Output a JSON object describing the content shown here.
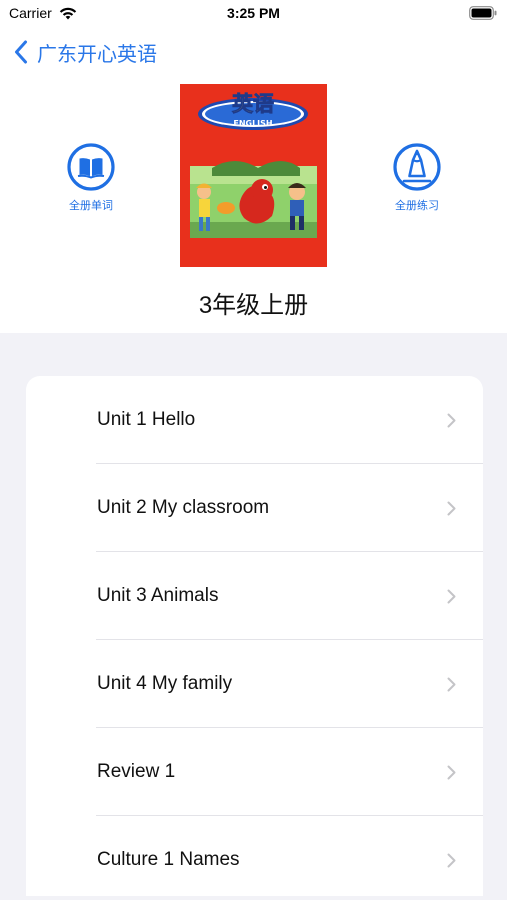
{
  "status_bar": {
    "carrier": "Carrier",
    "time": "3:25 PM"
  },
  "nav": {
    "back_label": "广东开心英语",
    "back_icon": "chevron-left-icon"
  },
  "actions": {
    "all_words": {
      "label": "全册单词",
      "icon": "book-open-icon"
    },
    "all_practice": {
      "label": "全册练习",
      "icon": "pencil-icon"
    }
  },
  "book": {
    "cover_title": "英语",
    "cover_subtitle": "ENGLISH",
    "title": "3年级上册"
  },
  "units": [
    {
      "label": "Unit 1 Hello"
    },
    {
      "label": "Unit 2 My classroom"
    },
    {
      "label": "Unit 3 Animals"
    },
    {
      "label": "Unit 4 My family"
    },
    {
      "label": "Review 1"
    },
    {
      "label": "Culture 1 Names"
    }
  ],
  "colors": {
    "accent": "#2a77e8",
    "cover_red": "#e8301c",
    "group_background": "#f2f2f7"
  }
}
